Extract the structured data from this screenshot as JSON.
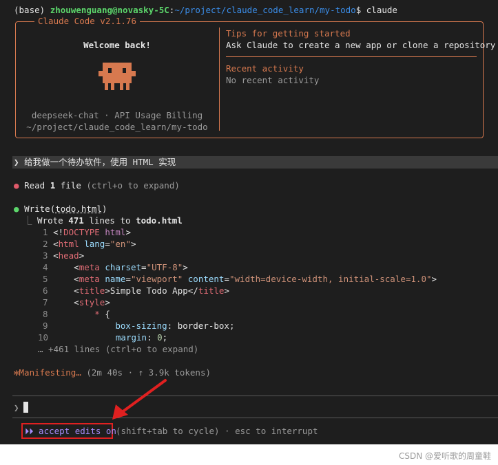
{
  "shell": {
    "env": "(base)",
    "userhost": "zhouwenguang@novasky-5C",
    "colon": ":",
    "path": "~/project/claude_code_learn/my-todo",
    "dollar": "$",
    "command": "claude"
  },
  "welcome": {
    "title": "Claude Code v2.1.76",
    "greeting": "Welcome back!",
    "model_line": "deepseek-chat · API Usage Billing",
    "cwd": "~/project/claude_code_learn/my-todo",
    "tips_heading": "Tips for getting started",
    "tips_text": "Ask Claude to create a new app or clone a repository",
    "recent_heading": "Recent activity",
    "recent_text": "No recent activity",
    "accent_color": "#d7794f"
  },
  "user_prompt": {
    "chevron": "❯",
    "text": "给我做一个待办软件，使用 HTML 实现"
  },
  "read_step": {
    "bullet": "●",
    "action": "Read",
    "count": "1",
    "unit": "file",
    "hint": "(ctrl+o to expand)"
  },
  "write_step": {
    "bullet": "●",
    "action": "Write",
    "target": "todo.html",
    "result_prefix": "⎿",
    "result_wrote": "Wrote",
    "result_lines": "471",
    "result_mid": "lines to",
    "result_file": "todo.html",
    "more": "… +461 lines (ctrl+o to expand)"
  },
  "code_lines": [
    {
      "n": "1"
    },
    {
      "n": "2"
    },
    {
      "n": "3"
    },
    {
      "n": "4"
    },
    {
      "n": "5"
    },
    {
      "n": "6"
    },
    {
      "n": "7"
    },
    {
      "n": "8"
    },
    {
      "n": "9"
    },
    {
      "n": "10"
    }
  ],
  "code_text": {
    "l1_a": "<!",
    "l1_b": "DOCTYPE",
    "l1_c": " html",
    "l1_d": ">",
    "l2_a": "<",
    "l2_b": "html",
    "l2_c": " lang",
    "l2_d": "=",
    "l2_e": "\"en\"",
    "l2_f": ">",
    "l3_a": "<",
    "l3_b": "head",
    "l3_c": ">",
    "l4_a": "<",
    "l4_b": "meta",
    "l4_c": " charset",
    "l4_d": "=",
    "l4_e": "\"UTF-8\"",
    "l4_f": ">",
    "l5_a": "<",
    "l5_b": "meta",
    "l5_c": " name",
    "l5_d": "=",
    "l5_e": "\"viewport\"",
    "l5_f": " content",
    "l5_g": "=",
    "l5_h": "\"width=device-width, initial-scale=1.0\"",
    "l5_i": ">",
    "l6_a": "<",
    "l6_b": "title",
    "l6_c": ">",
    "l6_d": "Simple Todo App",
    "l6_e": "</",
    "l6_f": "title",
    "l6_g": ">",
    "l7_a": "<",
    "l7_b": "style",
    "l7_c": ">",
    "l8_a": "*",
    "l8_b": " {",
    "l9_a": "box-sizing",
    "l9_b": ": border-box;",
    "l10_a": "margin",
    "l10_b": ": ",
    "l10_c": "0",
    "l10_d": ";"
  },
  "status": {
    "spinner": "✻",
    "label": "Manifesting…",
    "detail": "(2m 40s · ↑ 3.9k tokens)"
  },
  "input": {
    "chevron": "❯"
  },
  "footer": {
    "mode_icon": "⏵⏵",
    "mode_label": "accept edits on",
    "hint": "(shift+tab to cycle) · esc to interrupt"
  },
  "watermark": "CSDN @爱听歌的周童鞋"
}
